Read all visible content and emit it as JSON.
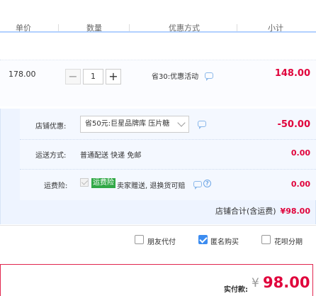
{
  "header": {
    "columns": [
      "单价",
      "数量",
      "优惠方式",
      "小计"
    ]
  },
  "item": {
    "unit_price": "178.00",
    "quantity": "1",
    "promo": "省30:优惠活动",
    "subtotal": "148.00"
  },
  "shop": {
    "coupon_label": "店铺优惠:",
    "coupon_selected": "省50元:巨星品牌库 压片糖",
    "coupon_amount": "-50.00",
    "shipping_label": "运送方式:",
    "shipping_value": "普通配送 快递 免邮",
    "shipping_amount": "0.00",
    "insurance_label": "运费险:",
    "insurance_tag": "运费险",
    "insurance_desc": "卖家赠送, 退换货可赔",
    "insurance_amount": "0.00",
    "total_label": "店铺合计(含运费)",
    "total_value": "¥98.00"
  },
  "options": {
    "friend_pay": "朋友代付",
    "anonymous": "匿名购买",
    "installment": "花呗分期"
  },
  "payment": {
    "label": "实付款:",
    "currency": "¥",
    "amount": "98.00"
  },
  "colors": {
    "accent_red": "#e0043c",
    "blue_check": "#3c8cf0",
    "green_tag": "#31a846"
  }
}
